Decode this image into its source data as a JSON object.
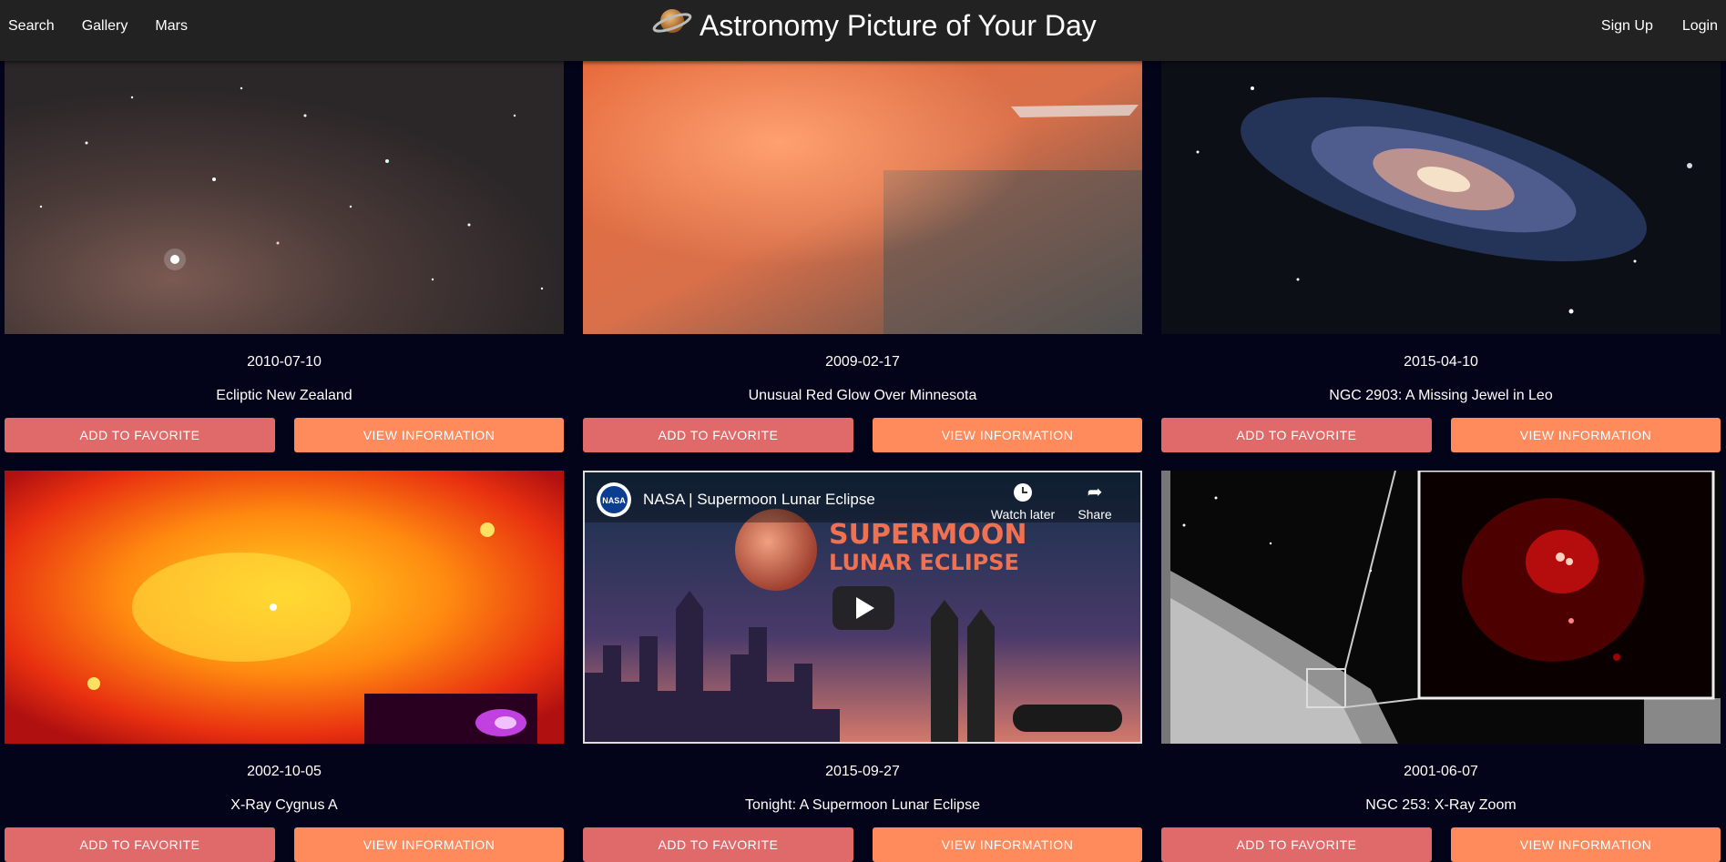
{
  "nav": {
    "left": [
      "Search",
      "Gallery",
      "Mars"
    ],
    "right": [
      "Sign Up",
      "Login"
    ],
    "brand_title": "Astronomy Picture of Your Day",
    "brand_icon": "saturn-icon"
  },
  "buttons": {
    "favorite": "ADD TO FAVORITE",
    "info": "VIEW INFORMATION"
  },
  "cards": [
    {
      "date": "2010-07-10",
      "title": "Ecliptic New Zealand"
    },
    {
      "date": "2009-02-17",
      "title": "Unusual Red Glow Over Minnesota"
    },
    {
      "date": "2015-04-10",
      "title": "NGC 2903: A Missing Jewel in Leo"
    },
    {
      "date": "2002-10-05",
      "title": "X-Ray Cygnus A"
    },
    {
      "date": "2015-09-27",
      "title": "Tonight: A Supermoon Lunar Eclipse"
    },
    {
      "date": "2001-06-07",
      "title": "NGC 253: X-Ray Zoom"
    }
  ],
  "video": {
    "channel_badge": "NASA",
    "title": "NASA | Supermoon Lunar Eclipse",
    "watch_later": "Watch later",
    "share": "Share",
    "overlay_line1": "SUPERMOON",
    "overlay_line2": "LUNAR ECLIPSE"
  },
  "colors": {
    "background": "#03031a",
    "topbar": "#222222",
    "favorite_button": "#e06a6a",
    "info_button": "#ff8a5c"
  }
}
